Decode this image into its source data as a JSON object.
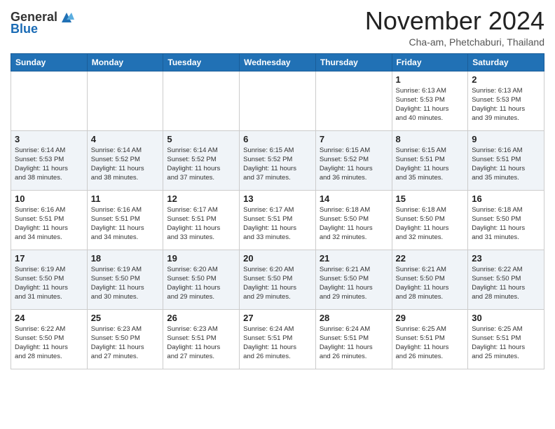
{
  "logo": {
    "general": "General",
    "blue": "Blue"
  },
  "header": {
    "month": "November 2024",
    "location": "Cha-am, Phetchaburi, Thailand"
  },
  "weekdays": [
    "Sunday",
    "Monday",
    "Tuesday",
    "Wednesday",
    "Thursday",
    "Friday",
    "Saturday"
  ],
  "weeks": [
    [
      {
        "day": "",
        "info": ""
      },
      {
        "day": "",
        "info": ""
      },
      {
        "day": "",
        "info": ""
      },
      {
        "day": "",
        "info": ""
      },
      {
        "day": "",
        "info": ""
      },
      {
        "day": "1",
        "info": "Sunrise: 6:13 AM\nSunset: 5:53 PM\nDaylight: 11 hours\nand 40 minutes."
      },
      {
        "day": "2",
        "info": "Sunrise: 6:13 AM\nSunset: 5:53 PM\nDaylight: 11 hours\nand 39 minutes."
      }
    ],
    [
      {
        "day": "3",
        "info": "Sunrise: 6:14 AM\nSunset: 5:53 PM\nDaylight: 11 hours\nand 38 minutes."
      },
      {
        "day": "4",
        "info": "Sunrise: 6:14 AM\nSunset: 5:52 PM\nDaylight: 11 hours\nand 38 minutes."
      },
      {
        "day": "5",
        "info": "Sunrise: 6:14 AM\nSunset: 5:52 PM\nDaylight: 11 hours\nand 37 minutes."
      },
      {
        "day": "6",
        "info": "Sunrise: 6:15 AM\nSunset: 5:52 PM\nDaylight: 11 hours\nand 37 minutes."
      },
      {
        "day": "7",
        "info": "Sunrise: 6:15 AM\nSunset: 5:52 PM\nDaylight: 11 hours\nand 36 minutes."
      },
      {
        "day": "8",
        "info": "Sunrise: 6:15 AM\nSunset: 5:51 PM\nDaylight: 11 hours\nand 35 minutes."
      },
      {
        "day": "9",
        "info": "Sunrise: 6:16 AM\nSunset: 5:51 PM\nDaylight: 11 hours\nand 35 minutes."
      }
    ],
    [
      {
        "day": "10",
        "info": "Sunrise: 6:16 AM\nSunset: 5:51 PM\nDaylight: 11 hours\nand 34 minutes."
      },
      {
        "day": "11",
        "info": "Sunrise: 6:16 AM\nSunset: 5:51 PM\nDaylight: 11 hours\nand 34 minutes."
      },
      {
        "day": "12",
        "info": "Sunrise: 6:17 AM\nSunset: 5:51 PM\nDaylight: 11 hours\nand 33 minutes."
      },
      {
        "day": "13",
        "info": "Sunrise: 6:17 AM\nSunset: 5:51 PM\nDaylight: 11 hours\nand 33 minutes."
      },
      {
        "day": "14",
        "info": "Sunrise: 6:18 AM\nSunset: 5:50 PM\nDaylight: 11 hours\nand 32 minutes."
      },
      {
        "day": "15",
        "info": "Sunrise: 6:18 AM\nSunset: 5:50 PM\nDaylight: 11 hours\nand 32 minutes."
      },
      {
        "day": "16",
        "info": "Sunrise: 6:18 AM\nSunset: 5:50 PM\nDaylight: 11 hours\nand 31 minutes."
      }
    ],
    [
      {
        "day": "17",
        "info": "Sunrise: 6:19 AM\nSunset: 5:50 PM\nDaylight: 11 hours\nand 31 minutes."
      },
      {
        "day": "18",
        "info": "Sunrise: 6:19 AM\nSunset: 5:50 PM\nDaylight: 11 hours\nand 30 minutes."
      },
      {
        "day": "19",
        "info": "Sunrise: 6:20 AM\nSunset: 5:50 PM\nDaylight: 11 hours\nand 29 minutes."
      },
      {
        "day": "20",
        "info": "Sunrise: 6:20 AM\nSunset: 5:50 PM\nDaylight: 11 hours\nand 29 minutes."
      },
      {
        "day": "21",
        "info": "Sunrise: 6:21 AM\nSunset: 5:50 PM\nDaylight: 11 hours\nand 29 minutes."
      },
      {
        "day": "22",
        "info": "Sunrise: 6:21 AM\nSunset: 5:50 PM\nDaylight: 11 hours\nand 28 minutes."
      },
      {
        "day": "23",
        "info": "Sunrise: 6:22 AM\nSunset: 5:50 PM\nDaylight: 11 hours\nand 28 minutes."
      }
    ],
    [
      {
        "day": "24",
        "info": "Sunrise: 6:22 AM\nSunset: 5:50 PM\nDaylight: 11 hours\nand 28 minutes."
      },
      {
        "day": "25",
        "info": "Sunrise: 6:23 AM\nSunset: 5:50 PM\nDaylight: 11 hours\nand 27 minutes."
      },
      {
        "day": "26",
        "info": "Sunrise: 6:23 AM\nSunset: 5:51 PM\nDaylight: 11 hours\nand 27 minutes."
      },
      {
        "day": "27",
        "info": "Sunrise: 6:24 AM\nSunset: 5:51 PM\nDaylight: 11 hours\nand 26 minutes."
      },
      {
        "day": "28",
        "info": "Sunrise: 6:24 AM\nSunset: 5:51 PM\nDaylight: 11 hours\nand 26 minutes."
      },
      {
        "day": "29",
        "info": "Sunrise: 6:25 AM\nSunset: 5:51 PM\nDaylight: 11 hours\nand 26 minutes."
      },
      {
        "day": "30",
        "info": "Sunrise: 6:25 AM\nSunset: 5:51 PM\nDaylight: 11 hours\nand 25 minutes."
      }
    ]
  ]
}
